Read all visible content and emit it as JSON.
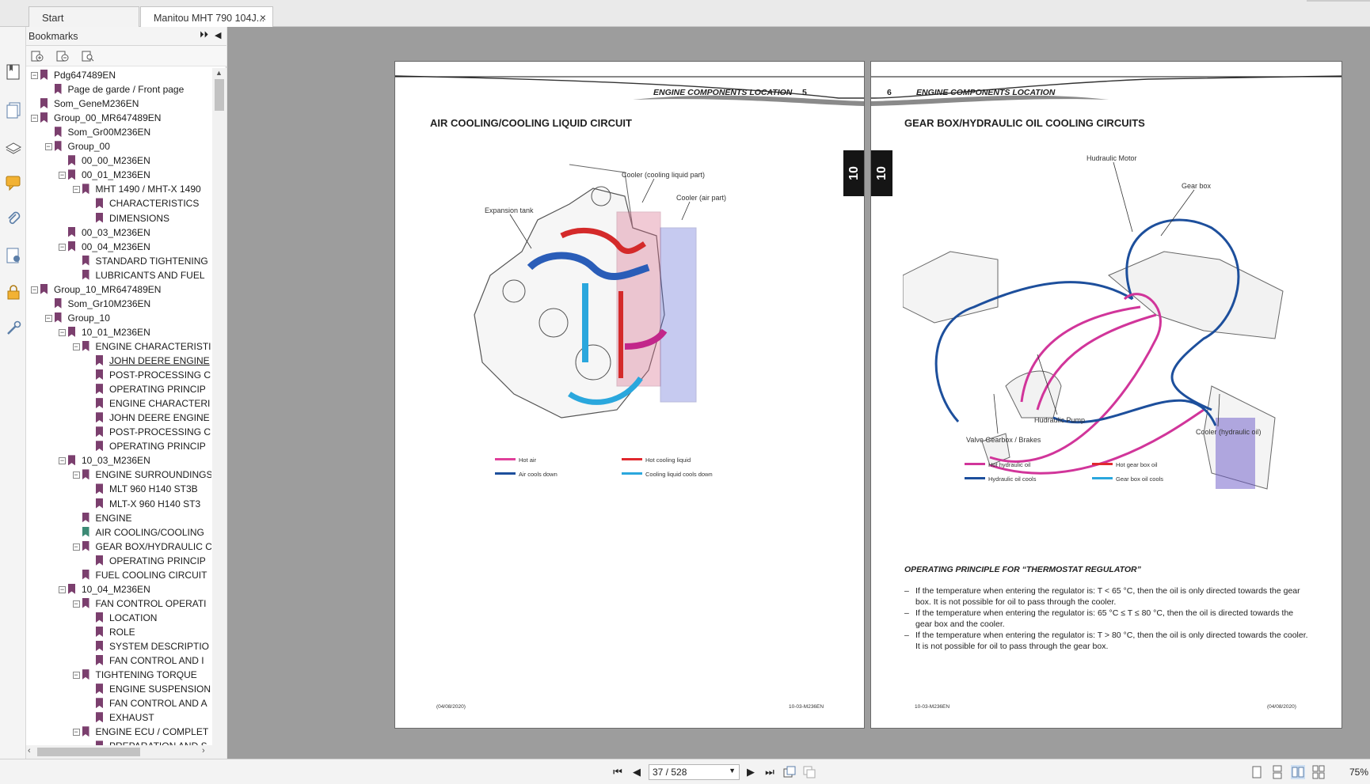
{
  "tabs": [
    {
      "label": "Start"
    },
    {
      "label": "Manitou MHT 790 104J...",
      "close": "×"
    }
  ],
  "bookmarks": {
    "title": "Bookmarks",
    "expand_all": "⏵⏵",
    "collapse": "◀",
    "items": [
      {
        "label": "Pdg647489EN",
        "level": 0,
        "toggle": "−"
      },
      {
        "label": "Page de garde / Front page",
        "level": 1,
        "toggle": ""
      },
      {
        "label": "Som_GeneM236EN",
        "level": 0,
        "toggle": ""
      },
      {
        "label": "Group_00_MR647489EN",
        "level": 0,
        "toggle": "−"
      },
      {
        "label": "Som_Gr00M236EN",
        "level": 1,
        "toggle": ""
      },
      {
        "label": "Group_00",
        "level": 1,
        "toggle": "−"
      },
      {
        "label": "00_00_M236EN",
        "level": 2,
        "toggle": ""
      },
      {
        "label": "00_01_M236EN",
        "level": 2,
        "toggle": "−"
      },
      {
        "label": "MHT 1490 / MHT-X 1490",
        "level": 3,
        "toggle": "−"
      },
      {
        "label": "CHARACTERISTICS",
        "level": 4,
        "toggle": ""
      },
      {
        "label": "DIMENSIONS",
        "level": 4,
        "toggle": ""
      },
      {
        "label": "00_03_M236EN",
        "level": 2,
        "toggle": ""
      },
      {
        "label": "00_04_M236EN",
        "level": 2,
        "toggle": "−"
      },
      {
        "label": "STANDARD TIGHTENING",
        "level": 3,
        "toggle": ""
      },
      {
        "label": "LUBRICANTS AND FUEL",
        "level": 3,
        "toggle": ""
      },
      {
        "label": "Group_10_MR647489EN",
        "level": 0,
        "toggle": "−"
      },
      {
        "label": "Som_Gr10M236EN",
        "level": 1,
        "toggle": ""
      },
      {
        "label": "Group_10",
        "level": 1,
        "toggle": "−"
      },
      {
        "label": "10_01_M236EN",
        "level": 2,
        "toggle": "−"
      },
      {
        "label": "ENGINE CHARACTERISTI",
        "level": 3,
        "toggle": "−"
      },
      {
        "label": "JOHN DEERE ENGINE",
        "level": 4,
        "toggle": "",
        "selected": true
      },
      {
        "label": "POST-PROCESSING C",
        "level": 4,
        "toggle": ""
      },
      {
        "label": "OPERATING PRINCIP",
        "level": 4,
        "toggle": ""
      },
      {
        "label": "ENGINE CHARACTERI",
        "level": 4,
        "toggle": ""
      },
      {
        "label": "JOHN DEERE ENGINE",
        "level": 4,
        "toggle": ""
      },
      {
        "label": "POST-PROCESSING C",
        "level": 4,
        "toggle": ""
      },
      {
        "label": "OPERATING PRINCIP",
        "level": 4,
        "toggle": ""
      },
      {
        "label": "10_03_M236EN",
        "level": 2,
        "toggle": "−"
      },
      {
        "label": "ENGINE SURROUNDINGS",
        "level": 3,
        "toggle": "−"
      },
      {
        "label": "MLT 960 H140 ST3B",
        "level": 4,
        "toggle": ""
      },
      {
        "label": "MLT-X 960 H140 ST3",
        "level": 4,
        "toggle": ""
      },
      {
        "label": "ENGINE",
        "level": 3,
        "toggle": ""
      },
      {
        "label": "AIR COOLING/COOLING",
        "level": 3,
        "toggle": "",
        "current": true
      },
      {
        "label": "GEAR BOX/HYDRAULIC C",
        "level": 3,
        "toggle": "−"
      },
      {
        "label": "OPERATING PRINCIP",
        "level": 4,
        "toggle": ""
      },
      {
        "label": "FUEL COOLING CIRCUIT",
        "level": 3,
        "toggle": ""
      },
      {
        "label": "10_04_M236EN",
        "level": 2,
        "toggle": "−"
      },
      {
        "label": "FAN CONTROL OPERATI",
        "level": 3,
        "toggle": "−"
      },
      {
        "label": "LOCATION",
        "level": 4,
        "toggle": ""
      },
      {
        "label": "ROLE",
        "level": 4,
        "toggle": ""
      },
      {
        "label": "SYSTEM DESCRIPTIO",
        "level": 4,
        "toggle": ""
      },
      {
        "label": "FAN CONTROL AND I",
        "level": 4,
        "toggle": ""
      },
      {
        "label": "TIGHTENING TORQUE",
        "level": 3,
        "toggle": "−"
      },
      {
        "label": "ENGINE SUSPENSION",
        "level": 4,
        "toggle": ""
      },
      {
        "label": "FAN CONTROL AND A",
        "level": 4,
        "toggle": ""
      },
      {
        "label": "EXHAUST",
        "level": 4,
        "toggle": ""
      },
      {
        "label": "ENGINE ECU / COMPLET",
        "level": 3,
        "toggle": "−"
      },
      {
        "label": "PREPARATION AND S",
        "level": 4,
        "toggle": ""
      }
    ]
  },
  "page_left": {
    "header": "ENGINE COMPONENTS LOCATION",
    "page_number": "5",
    "section_tab": "10",
    "title": "AIR COOLING/COOLING LIQUID CIRCUIT",
    "callouts": {
      "expansion_tank": "Expansion tank",
      "cooler_liquid": "Cooler (cooling liquid part)",
      "cooler_air": "Cooler (air part)"
    },
    "legend": [
      {
        "label": "Hot air",
        "color": "#e0409a"
      },
      {
        "label": "Hot cooling liquid",
        "color": "#e0282e"
      },
      {
        "label": "Air cools down",
        "color": "#1d4f9c"
      },
      {
        "label": "Cooling liquid cools down",
        "color": "#2aa7dd"
      }
    ],
    "footer_date": "(04/08/2020)",
    "footer_code": "10-03-M236EN"
  },
  "page_right": {
    "header": "ENGINE COMPONENTS LOCATION",
    "page_number": "6",
    "section_tab": "10",
    "title": "GEAR BOX/HYDRAULIC OIL COOLING CIRCUITS",
    "callouts": {
      "hydraulic_motor": "Hudraulic Motor",
      "gear_box": "Gear box",
      "hydraulic_pump": "Hudraulic Pump",
      "valve": "Valve Gearbox / Brakes",
      "cooler": "Cooler (hydraulic oil)"
    },
    "legend": [
      {
        "label": "Hot hydraulic oil",
        "color": "#d1359a"
      },
      {
        "label": "Hot gear box oil",
        "color": "#e0282e"
      },
      {
        "label": "Hydraulic oil cools",
        "color": "#1d4f9c"
      },
      {
        "label": "Gear box oil cools",
        "color": "#2aa7dd"
      }
    ],
    "operating_title": "OPERATING PRINCIPLE FOR “THERMOSTAT REGULATOR”",
    "bullets": [
      "If the temperature when entering the regulator is: T < 65 °C, then the oil is only directed towards the gear box. It is not possible for oil to pass through the cooler.",
      "If the temperature when entering the regulator is: 65 °C ≤ T ≤ 80 °C, then the oil is directed towards the gear box and the cooler.",
      "If the temperature when entering the regulator is: T > 80 °C, then the oil is only directed towards the cooler. It is not possible for oil to pass through the gear box."
    ],
    "bullet_dash": "–",
    "footer_code": "10-03-M236EN",
    "footer_date": "(04/08/2020)"
  },
  "statusbar": {
    "page_field": "37 / 528",
    "zoom": "75%"
  }
}
